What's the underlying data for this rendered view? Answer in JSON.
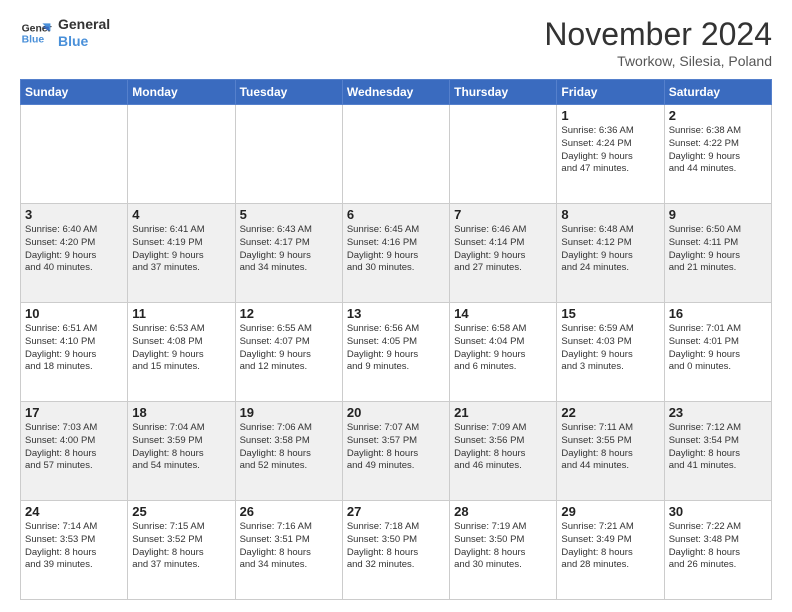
{
  "logo": {
    "line1": "General",
    "line2": "Blue"
  },
  "header": {
    "month": "November 2024",
    "location": "Tworkow, Silesia, Poland"
  },
  "weekdays": [
    "Sunday",
    "Monday",
    "Tuesday",
    "Wednesday",
    "Thursday",
    "Friday",
    "Saturday"
  ],
  "weeks": [
    [
      {
        "day": "",
        "info": ""
      },
      {
        "day": "",
        "info": ""
      },
      {
        "day": "",
        "info": ""
      },
      {
        "day": "",
        "info": ""
      },
      {
        "day": "",
        "info": ""
      },
      {
        "day": "1",
        "info": "Sunrise: 6:36 AM\nSunset: 4:24 PM\nDaylight: 9 hours\nand 47 minutes."
      },
      {
        "day": "2",
        "info": "Sunrise: 6:38 AM\nSunset: 4:22 PM\nDaylight: 9 hours\nand 44 minutes."
      }
    ],
    [
      {
        "day": "3",
        "info": "Sunrise: 6:40 AM\nSunset: 4:20 PM\nDaylight: 9 hours\nand 40 minutes."
      },
      {
        "day": "4",
        "info": "Sunrise: 6:41 AM\nSunset: 4:19 PM\nDaylight: 9 hours\nand 37 minutes."
      },
      {
        "day": "5",
        "info": "Sunrise: 6:43 AM\nSunset: 4:17 PM\nDaylight: 9 hours\nand 34 minutes."
      },
      {
        "day": "6",
        "info": "Sunrise: 6:45 AM\nSunset: 4:16 PM\nDaylight: 9 hours\nand 30 minutes."
      },
      {
        "day": "7",
        "info": "Sunrise: 6:46 AM\nSunset: 4:14 PM\nDaylight: 9 hours\nand 27 minutes."
      },
      {
        "day": "8",
        "info": "Sunrise: 6:48 AM\nSunset: 4:12 PM\nDaylight: 9 hours\nand 24 minutes."
      },
      {
        "day": "9",
        "info": "Sunrise: 6:50 AM\nSunset: 4:11 PM\nDaylight: 9 hours\nand 21 minutes."
      }
    ],
    [
      {
        "day": "10",
        "info": "Sunrise: 6:51 AM\nSunset: 4:10 PM\nDaylight: 9 hours\nand 18 minutes."
      },
      {
        "day": "11",
        "info": "Sunrise: 6:53 AM\nSunset: 4:08 PM\nDaylight: 9 hours\nand 15 minutes."
      },
      {
        "day": "12",
        "info": "Sunrise: 6:55 AM\nSunset: 4:07 PM\nDaylight: 9 hours\nand 12 minutes."
      },
      {
        "day": "13",
        "info": "Sunrise: 6:56 AM\nSunset: 4:05 PM\nDaylight: 9 hours\nand 9 minutes."
      },
      {
        "day": "14",
        "info": "Sunrise: 6:58 AM\nSunset: 4:04 PM\nDaylight: 9 hours\nand 6 minutes."
      },
      {
        "day": "15",
        "info": "Sunrise: 6:59 AM\nSunset: 4:03 PM\nDaylight: 9 hours\nand 3 minutes."
      },
      {
        "day": "16",
        "info": "Sunrise: 7:01 AM\nSunset: 4:01 PM\nDaylight: 9 hours\nand 0 minutes."
      }
    ],
    [
      {
        "day": "17",
        "info": "Sunrise: 7:03 AM\nSunset: 4:00 PM\nDaylight: 8 hours\nand 57 minutes."
      },
      {
        "day": "18",
        "info": "Sunrise: 7:04 AM\nSunset: 3:59 PM\nDaylight: 8 hours\nand 54 minutes."
      },
      {
        "day": "19",
        "info": "Sunrise: 7:06 AM\nSunset: 3:58 PM\nDaylight: 8 hours\nand 52 minutes."
      },
      {
        "day": "20",
        "info": "Sunrise: 7:07 AM\nSunset: 3:57 PM\nDaylight: 8 hours\nand 49 minutes."
      },
      {
        "day": "21",
        "info": "Sunrise: 7:09 AM\nSunset: 3:56 PM\nDaylight: 8 hours\nand 46 minutes."
      },
      {
        "day": "22",
        "info": "Sunrise: 7:11 AM\nSunset: 3:55 PM\nDaylight: 8 hours\nand 44 minutes."
      },
      {
        "day": "23",
        "info": "Sunrise: 7:12 AM\nSunset: 3:54 PM\nDaylight: 8 hours\nand 41 minutes."
      }
    ],
    [
      {
        "day": "24",
        "info": "Sunrise: 7:14 AM\nSunset: 3:53 PM\nDaylight: 8 hours\nand 39 minutes."
      },
      {
        "day": "25",
        "info": "Sunrise: 7:15 AM\nSunset: 3:52 PM\nDaylight: 8 hours\nand 37 minutes."
      },
      {
        "day": "26",
        "info": "Sunrise: 7:16 AM\nSunset: 3:51 PM\nDaylight: 8 hours\nand 34 minutes."
      },
      {
        "day": "27",
        "info": "Sunrise: 7:18 AM\nSunset: 3:50 PM\nDaylight: 8 hours\nand 32 minutes."
      },
      {
        "day": "28",
        "info": "Sunrise: 7:19 AM\nSunset: 3:50 PM\nDaylight: 8 hours\nand 30 minutes."
      },
      {
        "day": "29",
        "info": "Sunrise: 7:21 AM\nSunset: 3:49 PM\nDaylight: 8 hours\nand 28 minutes."
      },
      {
        "day": "30",
        "info": "Sunrise: 7:22 AM\nSunset: 3:48 PM\nDaylight: 8 hours\nand 26 minutes."
      }
    ]
  ]
}
